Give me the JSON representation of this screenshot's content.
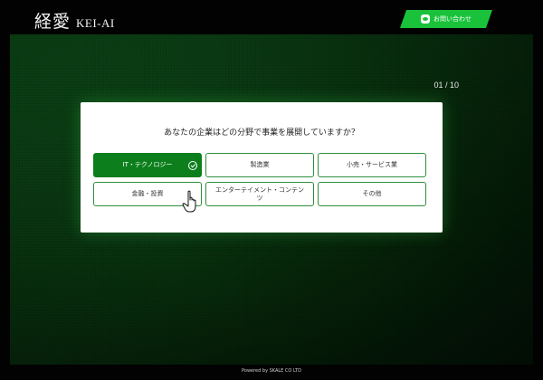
{
  "header": {
    "logo_kanji": "経愛",
    "logo_roman": "KEI-AI",
    "contact_label": "お問い合わせ",
    "contact_icon": "line-chat-icon"
  },
  "quiz": {
    "counter": "01 / 10",
    "question": "あなたの企業はどの分野で事業を展開していますか？",
    "options": [
      {
        "label": "IT・テクノロジー",
        "selected": true
      },
      {
        "label": "製造業",
        "selected": false
      },
      {
        "label": "小売・サービス業",
        "selected": false
      },
      {
        "label": "金融・投資",
        "selected": false
      },
      {
        "label": "エンターテイメント・コンテンツ",
        "selected": false
      },
      {
        "label": "その他",
        "selected": false
      }
    ]
  },
  "footer": {
    "text": "Powered by SKALE CO LTD"
  },
  "colors": {
    "accent": "#0c7f1c",
    "contact": "#19c23a",
    "background": "#020202"
  }
}
